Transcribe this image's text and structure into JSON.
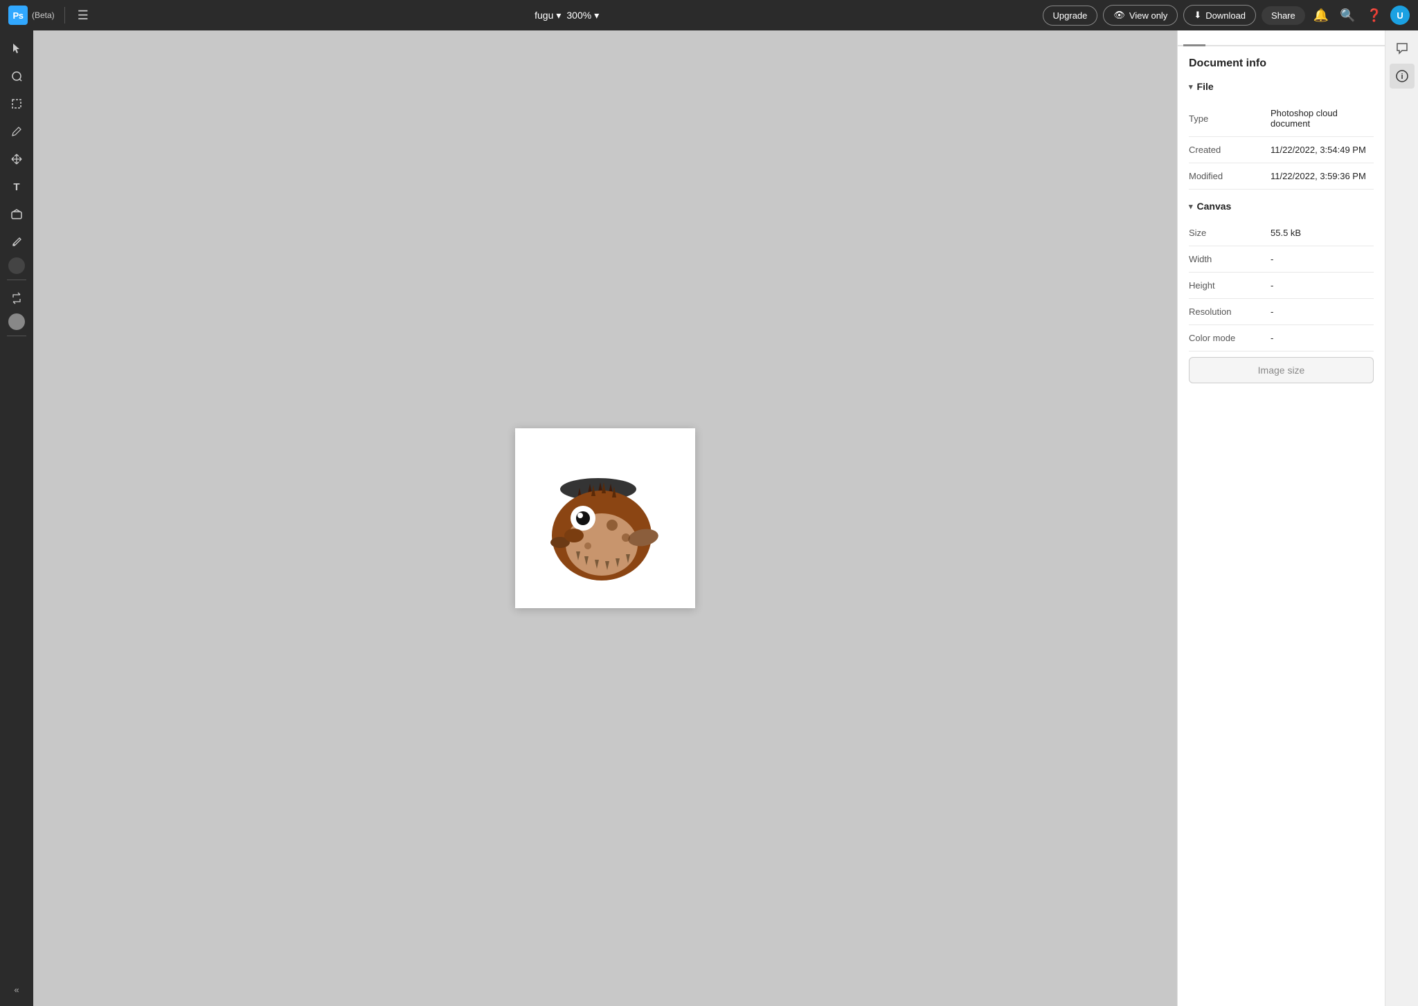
{
  "app": {
    "name": "Ps",
    "beta": "(Beta)",
    "file_name": "fugu",
    "zoom": "300%"
  },
  "topbar": {
    "upgrade_label": "Upgrade",
    "view_only_label": "View only",
    "download_label": "Download",
    "share_label": "Share"
  },
  "document_info": {
    "title": "Document info",
    "file_section": "File",
    "canvas_section": "Canvas",
    "type_label": "Type",
    "type_value": "Photoshop cloud document",
    "created_label": "Created",
    "created_value": "11/22/2022, 3:54:49 PM",
    "modified_label": "Modified",
    "modified_value": "11/22/2022, 3:59:36 PM",
    "size_label": "Size",
    "size_value": "55.5 kB",
    "width_label": "Width",
    "width_value": "-",
    "height_label": "Height",
    "height_value": "-",
    "resolution_label": "Resolution",
    "resolution_value": "-",
    "color_mode_label": "Color mode",
    "color_mode_value": "-",
    "image_size_btn": "Image size"
  },
  "colors": {
    "ps_blue": "#31a8ff",
    "topbar_bg": "#2b2b2b",
    "canvas_bg": "#c8c8c8",
    "panel_bg": "#ffffff"
  }
}
